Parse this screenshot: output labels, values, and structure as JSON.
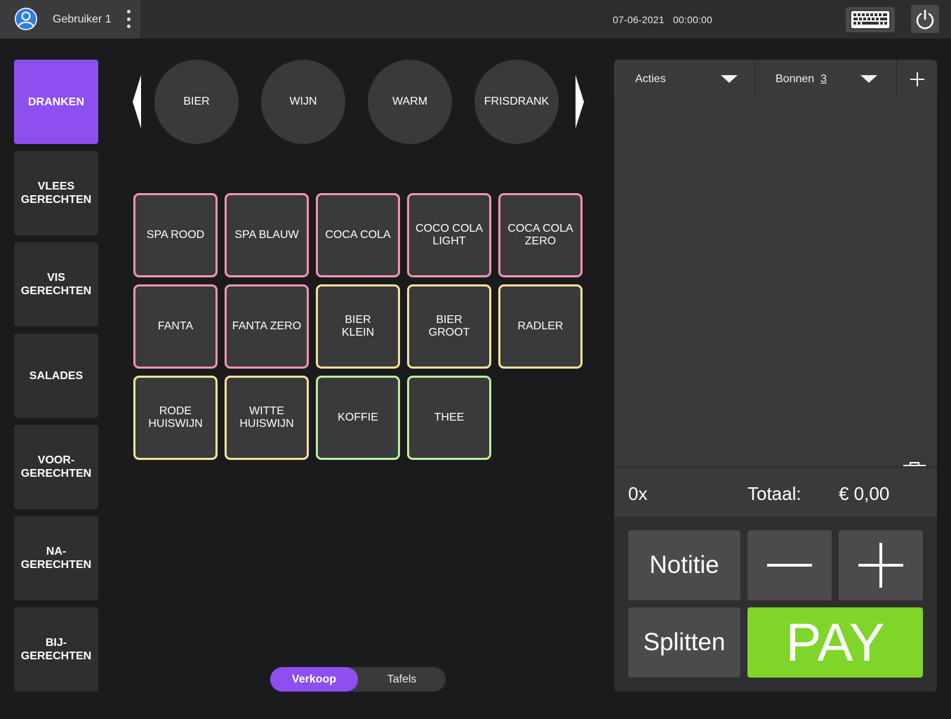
{
  "topbar": {
    "user_name": "Gebruiker 1",
    "date": "07-06-2021",
    "time": "00:00:00",
    "icons": [
      "user-avatar-icon",
      "kebab-menu-icon",
      "keyboard-icon",
      "power-icon"
    ]
  },
  "categories": [
    {
      "label": "DRANKEN",
      "active": true
    },
    {
      "label": "VLEES\nGERECHTEN"
    },
    {
      "label": "VIS\nGERECHTEN"
    },
    {
      "label": "SALADES"
    },
    {
      "label": "VOOR-\nGERECHTEN"
    },
    {
      "label": "NA-\nGERECHTEN"
    },
    {
      "label": "BIJ-\nGERECHTEN"
    }
  ],
  "subcategories": [
    "BIER",
    "WIJN",
    "WARM",
    "FRISDRANK"
  ],
  "products": [
    {
      "label": "SPA ROOD",
      "color": "#ef93b6"
    },
    {
      "label": "SPA BLAUW",
      "color": "#ef93b6"
    },
    {
      "label": "COCA COLA",
      "color": "#ef93b6"
    },
    {
      "label": "COCO COLA\nLIGHT",
      "color": "#ef93b6"
    },
    {
      "label": "COCA COLA\nZERO",
      "color": "#ef93b6"
    },
    {
      "label": "FANTA",
      "color": "#ef93b6"
    },
    {
      "label": "FANTA ZERO",
      "color": "#ef93b6"
    },
    {
      "label": "BIER\nKLEIN",
      "color": "#f2e29a"
    },
    {
      "label": "BIER\nGROOT",
      "color": "#f2e29a"
    },
    {
      "label": "RADLER",
      "color": "#f2e29a"
    },
    {
      "label": "RODE\nHUISWIJN",
      "color": "#f2e29a"
    },
    {
      "label": "WITTE\nHUISWIJN",
      "color": "#f2e29a"
    },
    {
      "label": "KOFFIE",
      "color": "#b6f09a"
    },
    {
      "label": "THEE",
      "color": "#b6f09a"
    }
  ],
  "mode_toggle": {
    "verkoop": "Verkoop",
    "tafels": "Tafels",
    "selected": "Verkoop"
  },
  "order_panel": {
    "acties": "Acties",
    "bonnen": "Bonnen",
    "bonnen_count": "3",
    "quantity": "0x",
    "total_label": "Totaal:",
    "total_value": "€ 0,00",
    "notitie": "Notitie",
    "splitten": "Splitten",
    "pay": "PAY"
  },
  "colors": {
    "accent": "#8e4ff0",
    "pay": "#7fd52a",
    "frisdrank": "#ef93b6",
    "alcohol": "#f2e29a",
    "warm": "#b6f09a"
  }
}
